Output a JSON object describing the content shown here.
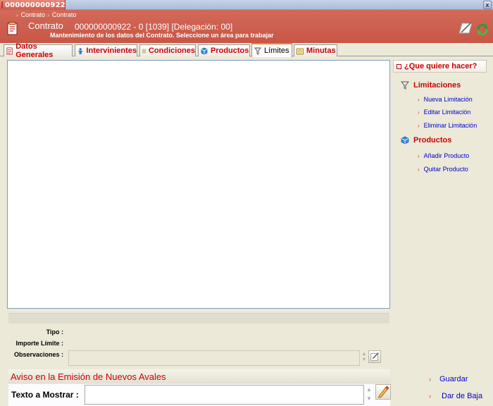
{
  "window": {
    "tab_title": "000000000922",
    "close_glyph": "x"
  },
  "breadcrumb": {
    "items": [
      "Contrato",
      "Contrato"
    ],
    "separator": "›"
  },
  "header": {
    "title": "Contrato",
    "subtitle": "000000000922 - 0 [1039] [Delegación: 00]",
    "description": "Mantenimiento de los datos del Contrato. Seleccione un área para trabajar",
    "icons": [
      "contract-document-icon",
      "edit-note-icon",
      "refresh-icon"
    ]
  },
  "tabs": [
    {
      "label": "Datos Generales",
      "icon": "document-icon",
      "active": false
    },
    {
      "label": "Intervinientes",
      "icon": "person-icon",
      "active": false
    },
    {
      "label": "Condiciones",
      "icon": "conditions-icon",
      "active": false
    },
    {
      "label": "Productos",
      "icon": "cube-icon",
      "active": false
    },
    {
      "label": "Límites",
      "icon": "filter-icon",
      "active": true
    },
    {
      "label": "Minutas",
      "icon": "minutes-icon",
      "active": false
    }
  ],
  "side": {
    "heading": "¿Que quiere hacer?",
    "sections": [
      {
        "title": "Limitaciones",
        "icon": "filter-icon",
        "links": [
          "Nueva Limitación",
          "Editar Limitación",
          "Eliminar Limitación"
        ]
      },
      {
        "title": "Productos",
        "icon": "cube-icon",
        "links": [
          "Añadir Producto",
          "Quitar Producto"
        ]
      }
    ],
    "link_bullet": "›"
  },
  "details": {
    "tipo_label": "Tipo :",
    "importe_label": "Importe Límite :",
    "observaciones_label": "Observaciones :"
  },
  "aviso": {
    "heading": "Aviso en la Emisión de Nuevos Avales",
    "texto_label": "Texto a Mostrar :",
    "texto_value": ""
  },
  "actions": {
    "save_label": "Guardar",
    "deactivate_label": "Dar de Baja",
    "bullet": "›"
  },
  "colors": {
    "header_bg": "#c85645",
    "accent_red": "#cc0000",
    "link_blue": "#0000cc",
    "tab_active_border": "#e68b2c"
  }
}
